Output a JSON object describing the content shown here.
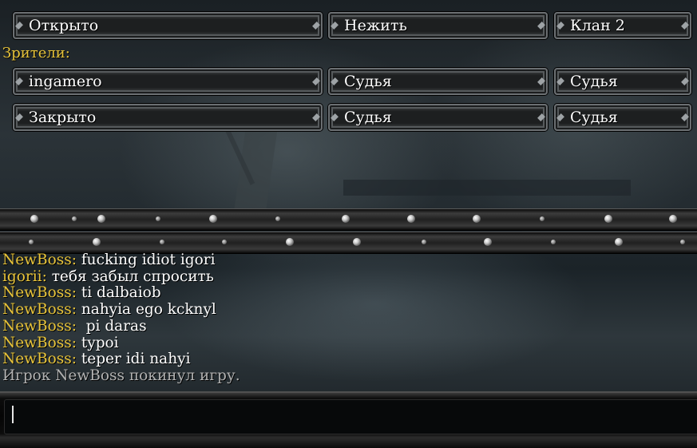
{
  "slots": [
    {
      "player": "Открыто",
      "race": "Нежить",
      "team": "Клан 2"
    }
  ],
  "spectators_label": "Зрители:",
  "spectators": [
    {
      "player": "ingamero",
      "race": "Судья",
      "team": "Судья"
    },
    {
      "player": "Закрыто",
      "race": "Судья",
      "team": "Судья"
    }
  ],
  "chat": [
    {
      "nick": "NewBoss:",
      "text": " fucking idiot igori"
    },
    {
      "nick": "igorii:",
      "text": " тебя забыл спросить"
    },
    {
      "nick": "NewBoss:",
      "text": " ti dalbaiob"
    },
    {
      "nick": "NewBoss:",
      "text": " nahyia ego kcknyl"
    },
    {
      "nick": "NewBoss:",
      "text": "  pi daras"
    },
    {
      "nick": "NewBoss:",
      "text": " typoi"
    },
    {
      "nick": "NewBoss:",
      "text": " teper idi nahyi"
    }
  ],
  "system_message": "Игрок NewBoss покинул игру.",
  "chat_input": {
    "value": ""
  },
  "colors": {
    "nick": "#e8c43a",
    "system": "#b2b2b2",
    "text": "#ffffff"
  }
}
